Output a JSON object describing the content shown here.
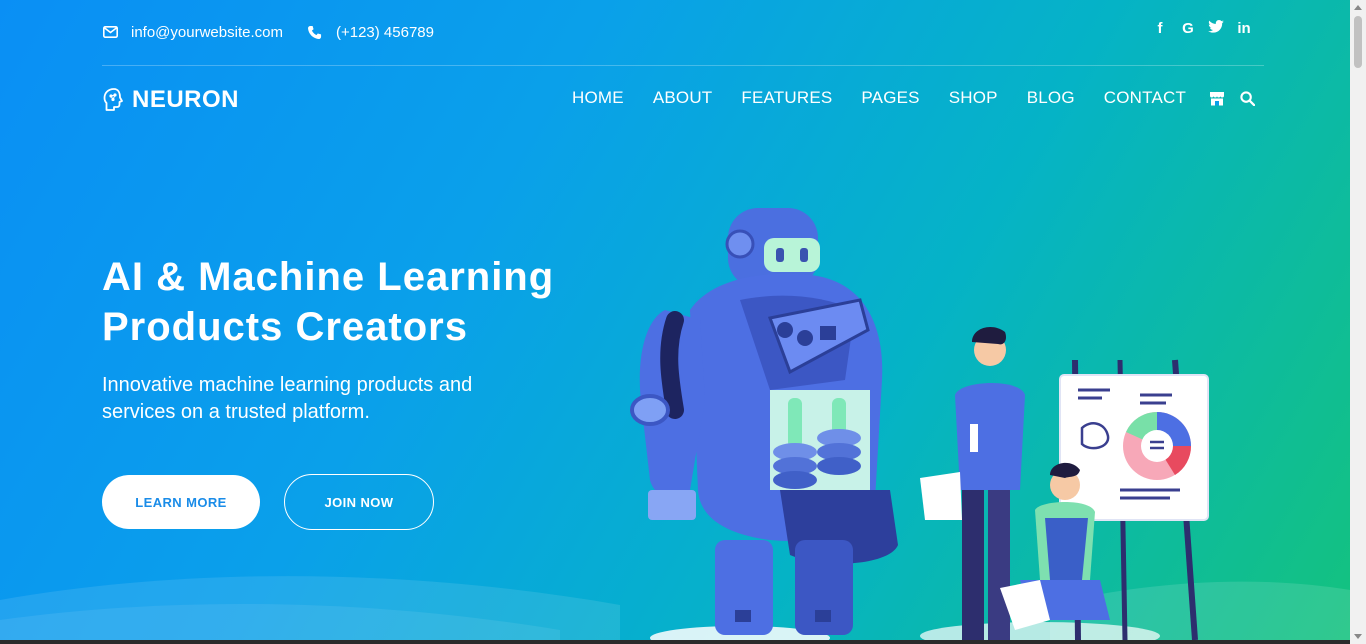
{
  "topbar": {
    "email": "info@yourwebsite.com",
    "phone": "(+123) 456789",
    "email_icon": "envelope-icon",
    "phone_icon": "phone-icon"
  },
  "social": {
    "facebook": "f",
    "google": "G",
    "twitter": "twitter-icon",
    "linkedin": "in"
  },
  "logo": {
    "text": "NEURON",
    "icon": "brain-head-icon"
  },
  "nav": {
    "home": "HOME",
    "about": "ABOUT",
    "features": "FEATURES",
    "pages": "PAGES",
    "shop": "SHOP",
    "blog": "BLOG",
    "contact": "CONTACT",
    "store_icon": "store-icon",
    "search_icon": "search-icon"
  },
  "hero": {
    "title_line1": "AI & Machine Learning",
    "title_line2": "Products Creators",
    "subtitle_line1": "Innovative machine learning products and",
    "subtitle_line2": "services on a trusted platform.",
    "learn_more": "LEARN MORE",
    "join_now": "JOIN NOW"
  },
  "colors": {
    "gradient_start": "#0a8ff5",
    "gradient_end": "#14c27e",
    "button_text": "#1a8ce8"
  }
}
